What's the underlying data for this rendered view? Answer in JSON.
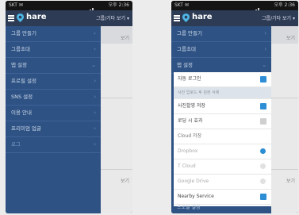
{
  "status": {
    "carrier": "SKT ✉",
    "time": "오후 2:36"
  },
  "appbar": {
    "title": "hare",
    "group": "그룹/기타 보기 ▾"
  },
  "left_drawer": {
    "items": [
      {
        "label": "그룹 만들기"
      },
      {
        "label": "그룹초대"
      },
      {
        "label": "앱 설정"
      },
      {
        "label": "프로필 설정"
      },
      {
        "label": "SNS 설정"
      },
      {
        "label": "이용 안내"
      },
      {
        "label": "프리미엄 업글"
      },
      {
        "label": "로그"
      }
    ]
  },
  "right_drawer": {
    "items": [
      {
        "label": "그룹 만들기"
      },
      {
        "label": "그룹초대"
      },
      {
        "label": "앱 설정"
      }
    ],
    "settings": {
      "auto_login": "자동 로그인",
      "note": "사진 업로드 후 원본 삭제",
      "check2": "사진촬영 저장",
      "check3": "로딩 시 효과",
      "cloud_header": "Cloud 저장",
      "clouds": [
        {
          "label": "Dropbox",
          "selected": true
        },
        {
          "label": "T Cloud",
          "selected": false
        },
        {
          "label": "Google Drive",
          "selected": false
        }
      ],
      "nearby": "Nearby Service"
    },
    "bottom_item": "프로필 설정"
  },
  "background": {
    "stub1": "보기",
    "stub2": "보기"
  }
}
